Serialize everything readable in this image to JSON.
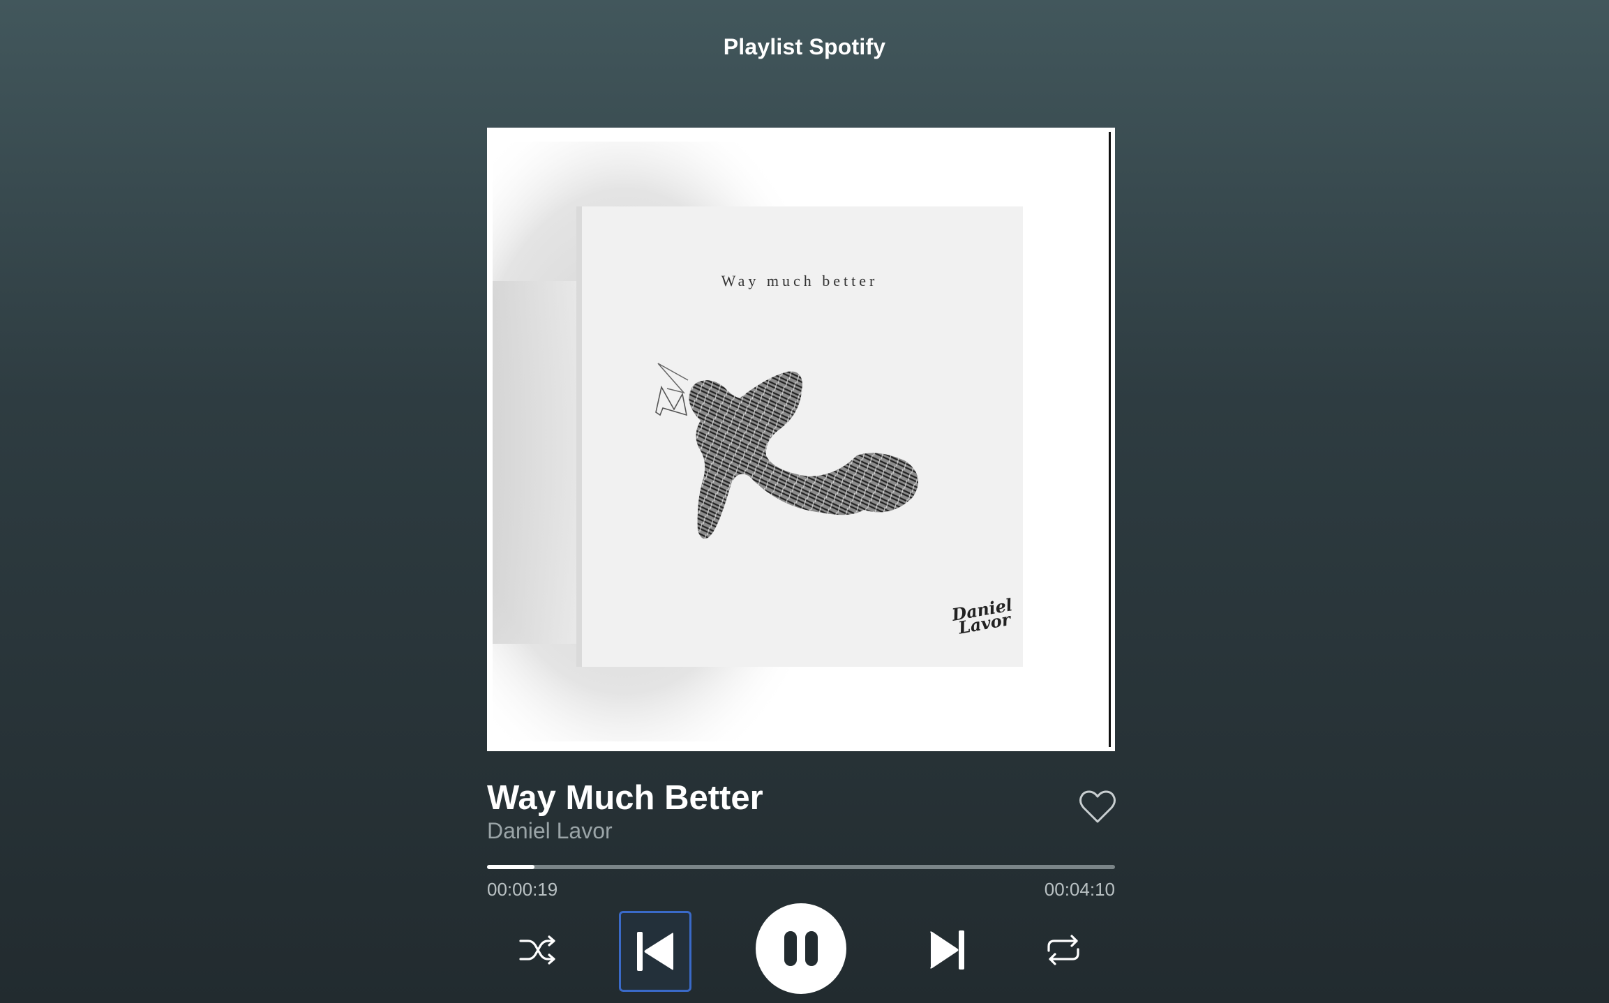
{
  "header": {
    "title": "Playlist Spotify"
  },
  "album_art": {
    "cover_text": "Way much better",
    "logo_line1": "Daniel",
    "logo_line2": "Lavor"
  },
  "track": {
    "title": "Way Much Better",
    "artist": "Daniel Lavor",
    "liked": false
  },
  "player": {
    "current_time": "00:00:19",
    "total_time": "00:04:10",
    "progress_fraction": 0.076,
    "is_playing": true
  },
  "controls": [
    {
      "name": "shuffle",
      "icon": "shuffle-icon"
    },
    {
      "name": "previous",
      "icon": "skip-previous-icon",
      "focused": true
    },
    {
      "name": "pause",
      "icon": "pause-icon"
    },
    {
      "name": "next",
      "icon": "skip-next-icon"
    },
    {
      "name": "repeat",
      "icon": "repeat-icon"
    }
  ],
  "colors": {
    "background_top": "#42575c",
    "background_bottom": "#222b2f",
    "focus_ring": "#3a6ac8",
    "muted_text": "#9aa4a7"
  }
}
